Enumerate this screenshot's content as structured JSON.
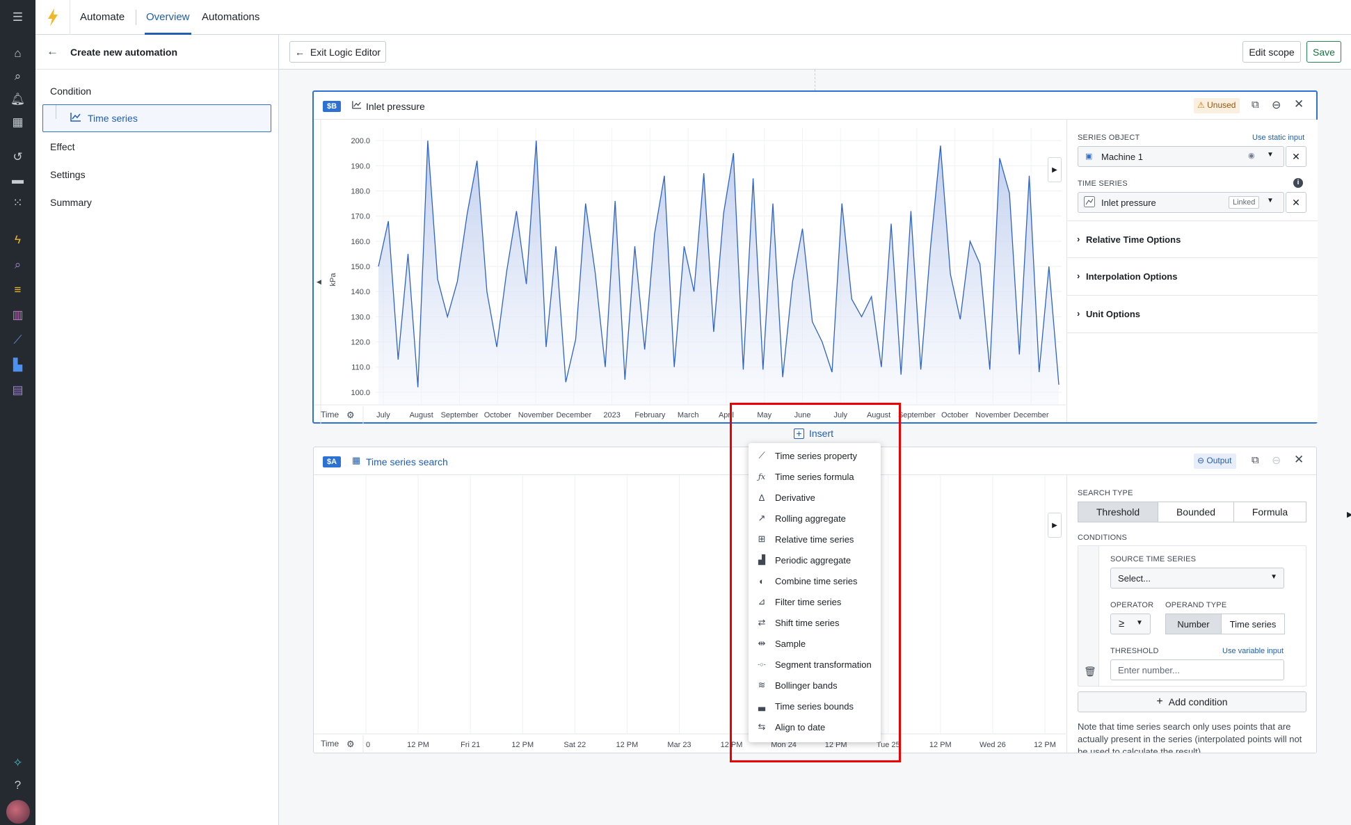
{
  "app": {
    "tabs": [
      "Automate",
      "Overview",
      "Automations"
    ],
    "active_tab": "Overview"
  },
  "left_panel": {
    "title": "Create new automation",
    "items": [
      "Condition",
      "Time series",
      "Effect",
      "Settings",
      "Summary"
    ]
  },
  "header": {
    "exit_label": "Exit Logic Editor",
    "edit_scope_label": "Edit scope",
    "save_label": "Save"
  },
  "card_b": {
    "tag": "$B",
    "title": "Inlet pressure",
    "status": "Unused",
    "chart_data": {
      "type": "area",
      "ylabel": "kPa",
      "ylim": [
        95,
        205
      ],
      "yticks": [
        "200.0",
        "190.0",
        "180.0",
        "170.0",
        "160.0",
        "150.0",
        "140.0",
        "130.0",
        "120.0",
        "110.0",
        "100.0"
      ],
      "xlabel": "Time",
      "xticks": [
        "July",
        "August",
        "September",
        "October",
        "November",
        "December",
        "2023",
        "February",
        "March",
        "April",
        "May",
        "June",
        "July",
        "August",
        "September",
        "October",
        "November",
        "December"
      ],
      "values": [
        150,
        168,
        113,
        155,
        102,
        200,
        145,
        130,
        144,
        171,
        192,
        140,
        118,
        148,
        172,
        143,
        200,
        118,
        158,
        104,
        121,
        175,
        147,
        110,
        176,
        105,
        158,
        117,
        163,
        186,
        110,
        158,
        140,
        187,
        124,
        171,
        195,
        109,
        185,
        109,
        175,
        106,
        144,
        165,
        128,
        120,
        108,
        175,
        137,
        130,
        138,
        110,
        167,
        107,
        172,
        109,
        158,
        198,
        147,
        129,
        160,
        151,
        109,
        193,
        179,
        115,
        186,
        108,
        150,
        103
      ],
      "color": "#2d62c8"
    },
    "side": {
      "series_object_label": "SERIES OBJECT",
      "use_static_input": "Use static input",
      "series_object_value": "Machine 1",
      "time_series_label": "TIME SERIES",
      "time_series_value": "Inlet pressure",
      "linked_badge": "Linked",
      "accordions": [
        "Relative Time Options",
        "Interpolation Options",
        "Unit Options"
      ]
    }
  },
  "insert_label": "Insert",
  "card_a": {
    "tag": "$A",
    "title": "Time series search",
    "output_label": "Output",
    "xlabel": "Time",
    "xticks": [
      "0",
      "12 PM",
      "Fri 21",
      "12 PM",
      "Sat 22",
      "12 PM",
      "Mar 23",
      "12 PM",
      "Mon 24",
      "12 PM",
      "Tue 25",
      "12 PM",
      "Wed 26",
      "12 PM"
    ],
    "side": {
      "search_type_label": "SEARCH TYPE",
      "search_types": [
        "Threshold",
        "Bounded",
        "Formula"
      ],
      "conditions_label": "CONDITIONS",
      "source_label": "SOURCE TIME SERIES",
      "source_placeholder": "Select...",
      "operator_label": "OPERATOR",
      "operator_value": "≥",
      "operand_type_label": "OPERAND TYPE",
      "operand_types": [
        "Number",
        "Time series"
      ],
      "threshold_label": "THRESHOLD",
      "use_variable_input": "Use variable input",
      "threshold_placeholder": "Enter number...",
      "add_condition": "Add condition",
      "note": "Note that time series search only uses points that are actually present in the series (interpolated points will not be used to calculate the result)."
    }
  },
  "menu": {
    "items": [
      {
        "label": "Time series property",
        "icon": "line-chart-icon"
      },
      {
        "label": "Time series formula",
        "icon": "function-icon"
      },
      {
        "label": "Derivative",
        "icon": "delta-icon"
      },
      {
        "label": "Rolling aggregate",
        "icon": "trend-icon"
      },
      {
        "label": "Relative time series",
        "icon": "relative-icon"
      },
      {
        "label": "Periodic aggregate",
        "icon": "bar-chart-icon"
      },
      {
        "label": "Combine time series",
        "icon": "combine-icon"
      },
      {
        "label": "Filter time series",
        "icon": "filter-chart-icon"
      },
      {
        "label": "Shift time series",
        "icon": "swap-icon"
      },
      {
        "label": "Sample",
        "icon": "sample-icon"
      },
      {
        "label": "Segment transformation",
        "icon": "segment-icon"
      },
      {
        "label": "Bollinger bands",
        "icon": "bands-icon"
      },
      {
        "label": "Time series bounds",
        "icon": "area-chart-icon"
      },
      {
        "label": "Align to date",
        "icon": "align-icon"
      }
    ]
  }
}
